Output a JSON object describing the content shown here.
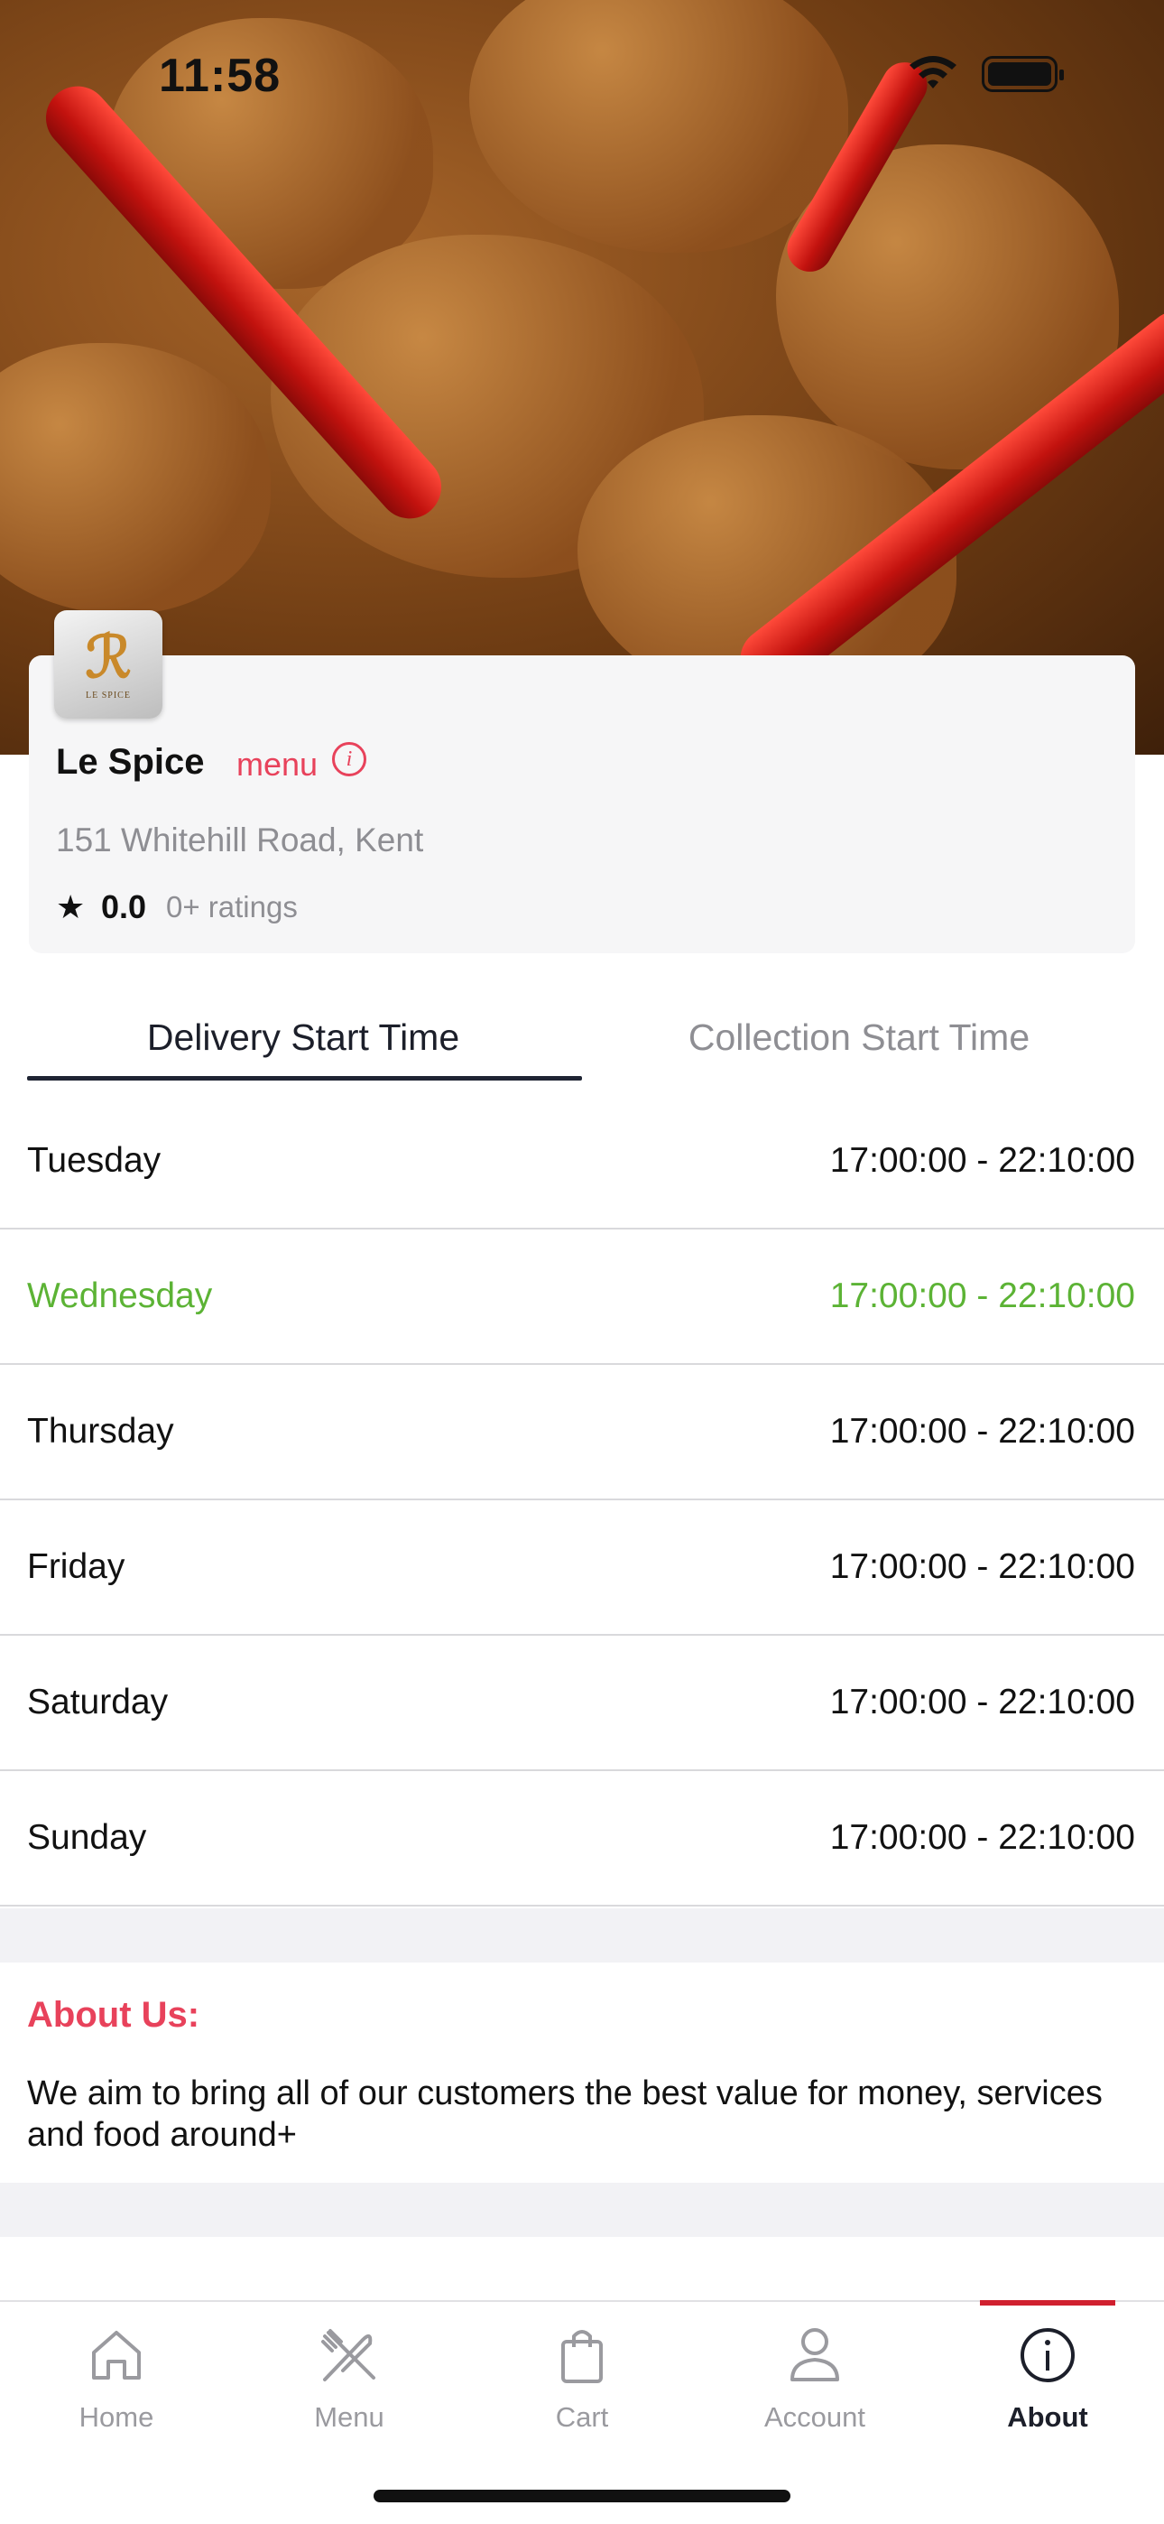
{
  "status_bar": {
    "time": "11:58"
  },
  "restaurant": {
    "logo_text": "LE SPICE",
    "name": "Le Spice",
    "menu_link": "menu",
    "info_icon": "info-icon",
    "address": "151 Whitehill Road, Kent",
    "rating": "0.0",
    "rating_count": "0+ ratings"
  },
  "tabs": {
    "delivery": "Delivery Start Time",
    "collection": "Collection Start Time",
    "active": "delivery"
  },
  "schedule": [
    {
      "day": "Tuesday",
      "time": "17:00:00 - 22:10:00"
    },
    {
      "day": "Wednesday",
      "time": "17:00:00 - 22:10:00",
      "today": true
    },
    {
      "day": "Thursday",
      "time": "17:00:00 - 22:10:00"
    },
    {
      "day": "Friday",
      "time": "17:00:00 - 22:10:00"
    },
    {
      "day": "Saturday",
      "time": "17:00:00 - 22:10:00"
    },
    {
      "day": "Sunday",
      "time": "17:00:00 - 22:10:00"
    }
  ],
  "about": {
    "title": "About Us:",
    "text": "We aim to bring all of our customers the best value for money, services and food around+"
  },
  "tabbar": {
    "items": [
      {
        "label": "Home",
        "icon": "home-icon"
      },
      {
        "label": "Menu",
        "icon": "fork-knife-icon"
      },
      {
        "label": "Cart",
        "icon": "bag-icon"
      },
      {
        "label": "Account",
        "icon": "person-icon"
      },
      {
        "label": "About",
        "icon": "info-circle-icon",
        "active": true
      }
    ]
  },
  "colors": {
    "accent": "#e8425b",
    "today": "#5cb335",
    "tab_indicator": "#d0202e"
  }
}
